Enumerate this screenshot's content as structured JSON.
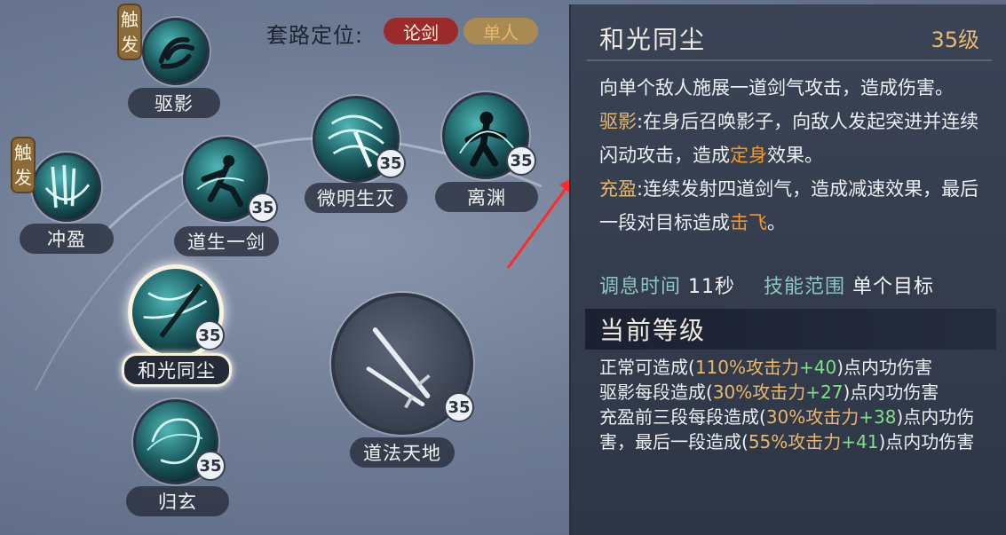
{
  "header": {
    "label": "套路定位:",
    "tags": [
      "论剑",
      "单人"
    ]
  },
  "colors": {
    "tag_red": "#9b2a2a",
    "tag_gold": "#a98a52",
    "level_gold": "#e9b96e",
    "keyword_gold": "#e8b86c",
    "keyword_orange": "#f09a2c",
    "bonus_green": "#7fe08a",
    "stat_label_teal": "#8ec7c1"
  },
  "skills": [
    {
      "name": "驱影",
      "trigger": "触发",
      "icon": "grasping-hand-icon"
    },
    {
      "name": "冲盈",
      "trigger": "触发",
      "icon": "spinning-swords-icon"
    },
    {
      "name": "道生一剑",
      "level": "35",
      "icon": "leaping-swordsman-icon"
    },
    {
      "name": "微明生灭",
      "level": "35",
      "icon": "sword-slash-icon"
    },
    {
      "name": "离渊",
      "level": "35",
      "icon": "shadow-warrior-icon"
    },
    {
      "name": "和光同尘",
      "level": "35",
      "icon": "sword-qi-icon",
      "selected": true
    },
    {
      "name": "归玄",
      "level": "35",
      "icon": "vortex-icon"
    },
    {
      "name": "道法天地",
      "level": "35",
      "icon": "twin-swords-icon"
    }
  ],
  "trigger_char_1": "触",
  "trigger_char_2": "发",
  "detail": {
    "title": "和光同尘",
    "level": "35级",
    "desc_main": "向单个敌人施展一道剑气攻击，造成伤害。",
    "qu_ying_label": "驱影",
    "qu_ying_text_a": ":在身后召唤影子，向敌人发起突进并连续闪动攻击，造成",
    "qu_ying_kw": "定身",
    "qu_ying_text_b": "效果。",
    "chong_ying_label": "充盈",
    "chong_ying_text_a": ":连续发射四道剑气，造成减速效果，最后一段对目标造成",
    "chong_ying_kw": "击飞",
    "chong_ying_text_b": "。",
    "cooldown_label": "调息时间",
    "cooldown_value": "11秒",
    "range_label": "技能范围",
    "range_value": "单个目标",
    "current_level_heading": "当前等级",
    "line1_a": "正常可造成(",
    "line1_pct": "110%攻击力",
    "line1_bonus": "+40",
    "line1_b": ")点内功伤害",
    "line2_a": "驱影每段造成(",
    "line2_pct": "30%攻击力",
    "line2_bonus": "+27",
    "line2_b": ")点内功伤害",
    "line3_a": "充盈前三段每段造成(",
    "line3_pct": "30%攻击力",
    "line3_bonus": "+38",
    "line3_b": ")点内功伤害，最后一段造成(",
    "line3_pct2": "55%攻击力",
    "line3_bonus2": "+41",
    "line3_c": ")点内功伤害"
  }
}
